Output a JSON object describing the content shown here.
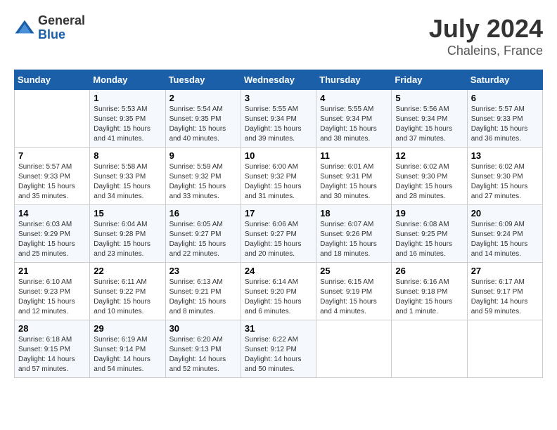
{
  "header": {
    "logo_line1": "General",
    "logo_line2": "Blue",
    "month_year": "July 2024",
    "location": "Chaleins, France"
  },
  "calendar": {
    "days_of_week": [
      "Sunday",
      "Monday",
      "Tuesday",
      "Wednesday",
      "Thursday",
      "Friday",
      "Saturday"
    ],
    "weeks": [
      [
        {
          "day": "",
          "info": ""
        },
        {
          "day": "1",
          "info": "Sunrise: 5:53 AM\nSunset: 9:35 PM\nDaylight: 15 hours\nand 41 minutes."
        },
        {
          "day": "2",
          "info": "Sunrise: 5:54 AM\nSunset: 9:35 PM\nDaylight: 15 hours\nand 40 minutes."
        },
        {
          "day": "3",
          "info": "Sunrise: 5:55 AM\nSunset: 9:34 PM\nDaylight: 15 hours\nand 39 minutes."
        },
        {
          "day": "4",
          "info": "Sunrise: 5:55 AM\nSunset: 9:34 PM\nDaylight: 15 hours\nand 38 minutes."
        },
        {
          "day": "5",
          "info": "Sunrise: 5:56 AM\nSunset: 9:34 PM\nDaylight: 15 hours\nand 37 minutes."
        },
        {
          "day": "6",
          "info": "Sunrise: 5:57 AM\nSunset: 9:33 PM\nDaylight: 15 hours\nand 36 minutes."
        }
      ],
      [
        {
          "day": "7",
          "info": "Sunrise: 5:57 AM\nSunset: 9:33 PM\nDaylight: 15 hours\nand 35 minutes."
        },
        {
          "day": "8",
          "info": "Sunrise: 5:58 AM\nSunset: 9:33 PM\nDaylight: 15 hours\nand 34 minutes."
        },
        {
          "day": "9",
          "info": "Sunrise: 5:59 AM\nSunset: 9:32 PM\nDaylight: 15 hours\nand 33 minutes."
        },
        {
          "day": "10",
          "info": "Sunrise: 6:00 AM\nSunset: 9:32 PM\nDaylight: 15 hours\nand 31 minutes."
        },
        {
          "day": "11",
          "info": "Sunrise: 6:01 AM\nSunset: 9:31 PM\nDaylight: 15 hours\nand 30 minutes."
        },
        {
          "day": "12",
          "info": "Sunrise: 6:02 AM\nSunset: 9:30 PM\nDaylight: 15 hours\nand 28 minutes."
        },
        {
          "day": "13",
          "info": "Sunrise: 6:02 AM\nSunset: 9:30 PM\nDaylight: 15 hours\nand 27 minutes."
        }
      ],
      [
        {
          "day": "14",
          "info": "Sunrise: 6:03 AM\nSunset: 9:29 PM\nDaylight: 15 hours\nand 25 minutes."
        },
        {
          "day": "15",
          "info": "Sunrise: 6:04 AM\nSunset: 9:28 PM\nDaylight: 15 hours\nand 23 minutes."
        },
        {
          "day": "16",
          "info": "Sunrise: 6:05 AM\nSunset: 9:27 PM\nDaylight: 15 hours\nand 22 minutes."
        },
        {
          "day": "17",
          "info": "Sunrise: 6:06 AM\nSunset: 9:27 PM\nDaylight: 15 hours\nand 20 minutes."
        },
        {
          "day": "18",
          "info": "Sunrise: 6:07 AM\nSunset: 9:26 PM\nDaylight: 15 hours\nand 18 minutes."
        },
        {
          "day": "19",
          "info": "Sunrise: 6:08 AM\nSunset: 9:25 PM\nDaylight: 15 hours\nand 16 minutes."
        },
        {
          "day": "20",
          "info": "Sunrise: 6:09 AM\nSunset: 9:24 PM\nDaylight: 15 hours\nand 14 minutes."
        }
      ],
      [
        {
          "day": "21",
          "info": "Sunrise: 6:10 AM\nSunset: 9:23 PM\nDaylight: 15 hours\nand 12 minutes."
        },
        {
          "day": "22",
          "info": "Sunrise: 6:11 AM\nSunset: 9:22 PM\nDaylight: 15 hours\nand 10 minutes."
        },
        {
          "day": "23",
          "info": "Sunrise: 6:13 AM\nSunset: 9:21 PM\nDaylight: 15 hours\nand 8 minutes."
        },
        {
          "day": "24",
          "info": "Sunrise: 6:14 AM\nSunset: 9:20 PM\nDaylight: 15 hours\nand 6 minutes."
        },
        {
          "day": "25",
          "info": "Sunrise: 6:15 AM\nSunset: 9:19 PM\nDaylight: 15 hours\nand 4 minutes."
        },
        {
          "day": "26",
          "info": "Sunrise: 6:16 AM\nSunset: 9:18 PM\nDaylight: 15 hours\nand 1 minute."
        },
        {
          "day": "27",
          "info": "Sunrise: 6:17 AM\nSunset: 9:17 PM\nDaylight: 14 hours\nand 59 minutes."
        }
      ],
      [
        {
          "day": "28",
          "info": "Sunrise: 6:18 AM\nSunset: 9:15 PM\nDaylight: 14 hours\nand 57 minutes."
        },
        {
          "day": "29",
          "info": "Sunrise: 6:19 AM\nSunset: 9:14 PM\nDaylight: 14 hours\nand 54 minutes."
        },
        {
          "day": "30",
          "info": "Sunrise: 6:20 AM\nSunset: 9:13 PM\nDaylight: 14 hours\nand 52 minutes."
        },
        {
          "day": "31",
          "info": "Sunrise: 6:22 AM\nSunset: 9:12 PM\nDaylight: 14 hours\nand 50 minutes."
        },
        {
          "day": "",
          "info": ""
        },
        {
          "day": "",
          "info": ""
        },
        {
          "day": "",
          "info": ""
        }
      ]
    ]
  }
}
